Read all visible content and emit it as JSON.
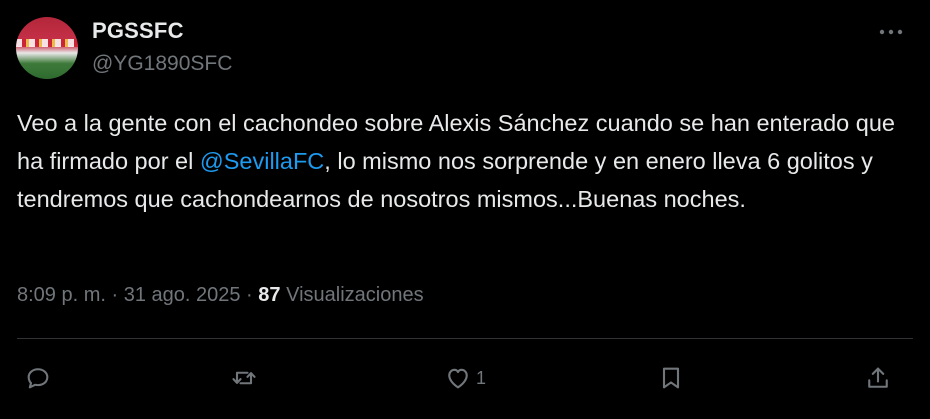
{
  "author": {
    "display_name": "PGSSFC",
    "handle": "@YG1890SFC"
  },
  "tweet": {
    "text_before_mention": "Veo a la gente con el cachondeo sobre Alexis Sánchez cuando se han enterado que ha firmado por el ",
    "mention": "@SevillaFC",
    "text_after_mention": ", lo mismo nos sorprende y en enero lleva 6 golitos y tendremos que cachondearnos de nosotros mismos...Buenas noches."
  },
  "meta": {
    "time": "8:09 p. m.",
    "separator": " · ",
    "date": "31 ago. 2025",
    "views_count": "87",
    "views_label": "Visualizaciones"
  },
  "actions": {
    "reply_icon": "reply-icon",
    "retweet_icon": "retweet-icon",
    "like_icon": "heart-icon",
    "like_count": "1",
    "bookmark_icon": "bookmark-icon",
    "share_icon": "share-icon",
    "more_icon": "more-icon"
  },
  "colors": {
    "background": "#000000",
    "text": "#e7e9ea",
    "secondary": "#71767b",
    "accent": "#1d9bf0",
    "divider": "#2f3336"
  }
}
